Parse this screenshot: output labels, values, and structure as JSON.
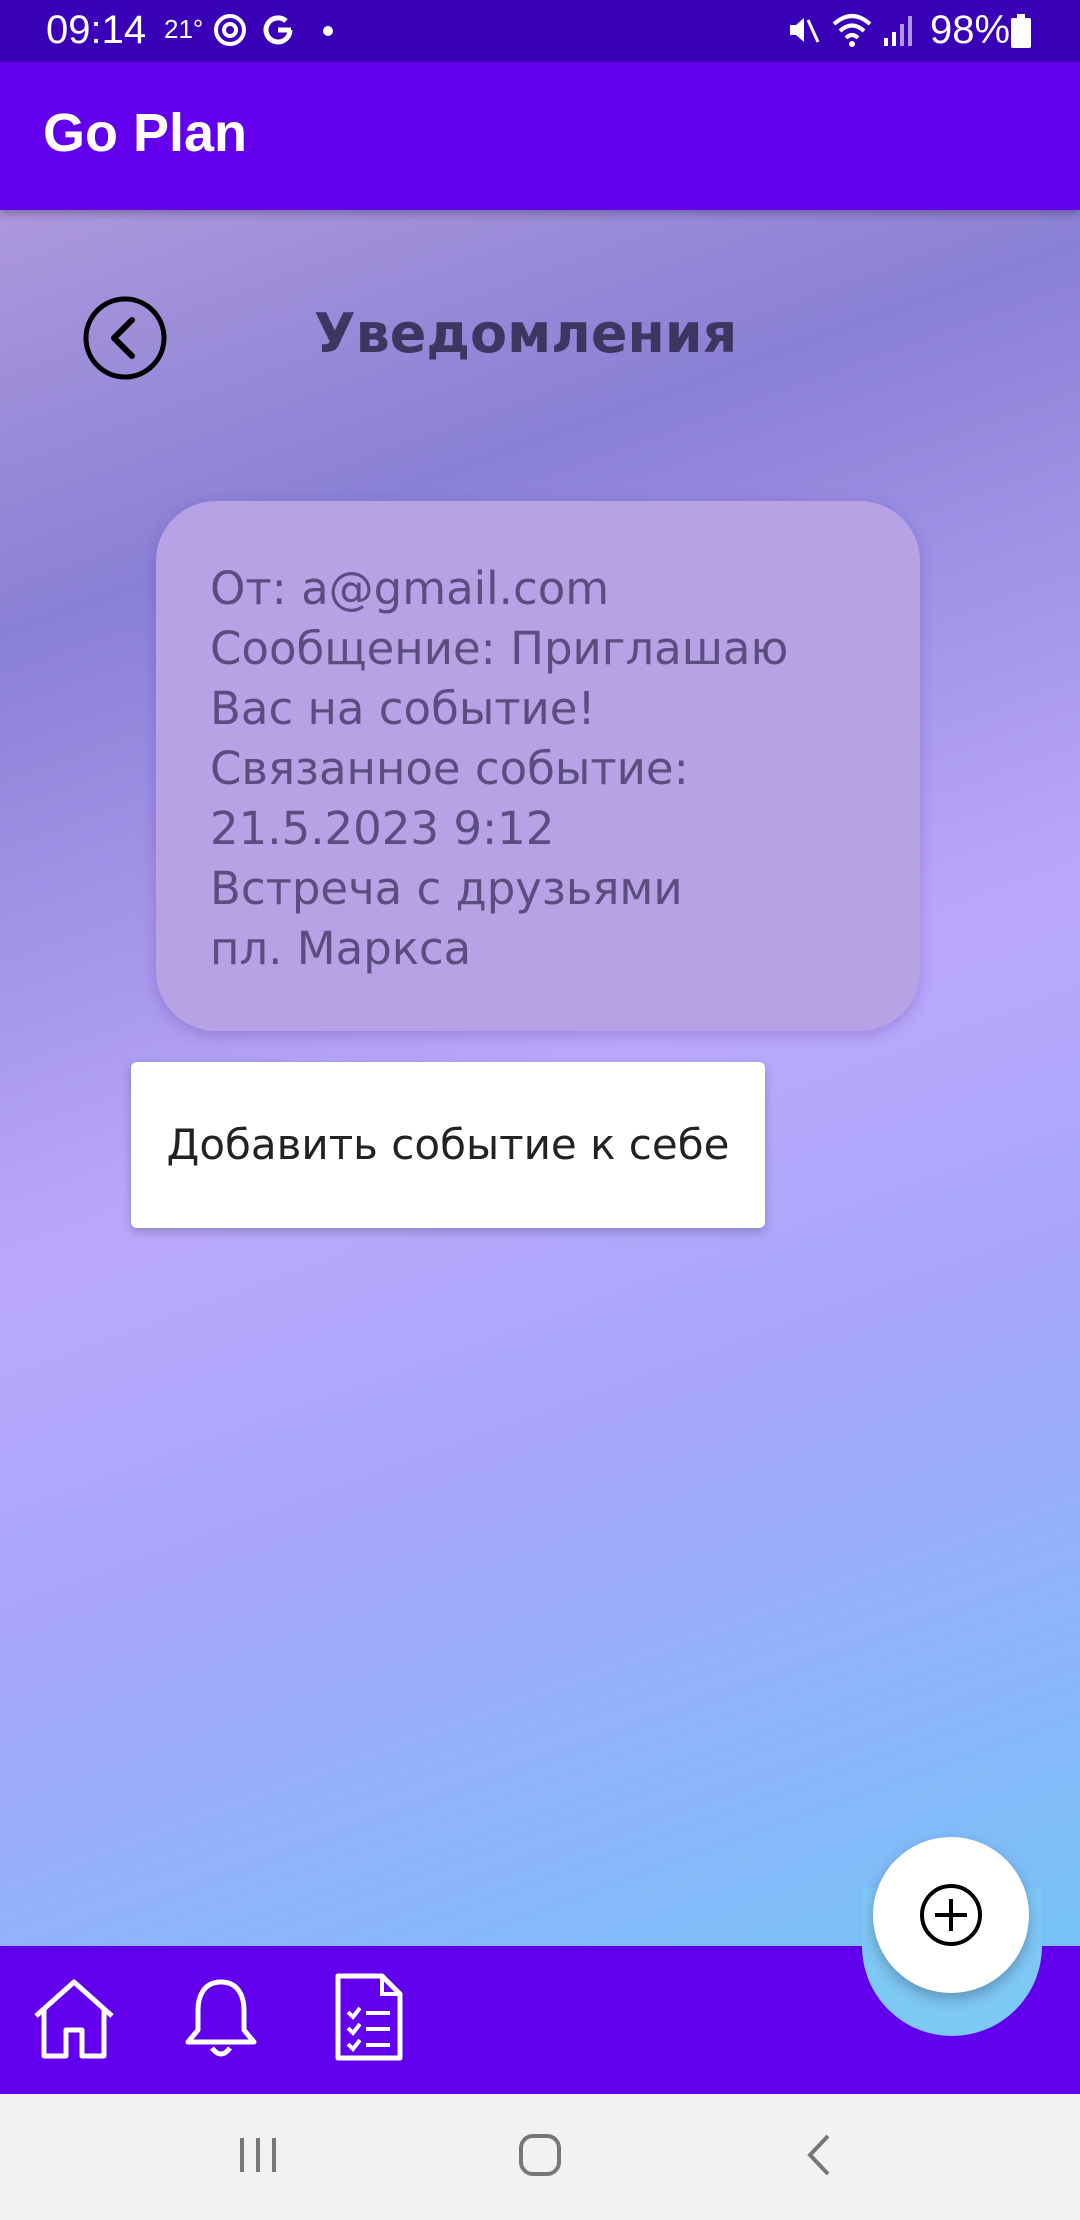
{
  "status_bar": {
    "time": "09:14",
    "temperature": "21°",
    "battery": "98%",
    "icons": [
      "weather-icon",
      "sync-icon",
      "google-icon",
      "dot-icon",
      "mute-icon",
      "wifi-icon",
      "signal-icon",
      "battery-icon"
    ]
  },
  "app_bar": {
    "title": "Go Plan"
  },
  "screen": {
    "title": "Уведомления",
    "back_icon": "chevron-left-circle-icon"
  },
  "notification": {
    "lines": [
      "От: a@gmail.com",
      "Сообщение: Приглашаю",
      "Вас на событие!",
      "Связанное событие:",
      "21.5.2023 9:12",
      "Встреча с друзьями",
      "пл. Маркса"
    ]
  },
  "actions": {
    "add_event_label": "Добавить событие к себе"
  },
  "bottom_nav": {
    "items": [
      "home-icon",
      "bell-icon",
      "checklist-icon"
    ],
    "fab_icon": "plus-circle-icon"
  },
  "colors": {
    "primary": "#6200ee",
    "status_bar": "#3a00b8",
    "card": "#b8a2e6",
    "title_text": "#3d3660"
  }
}
